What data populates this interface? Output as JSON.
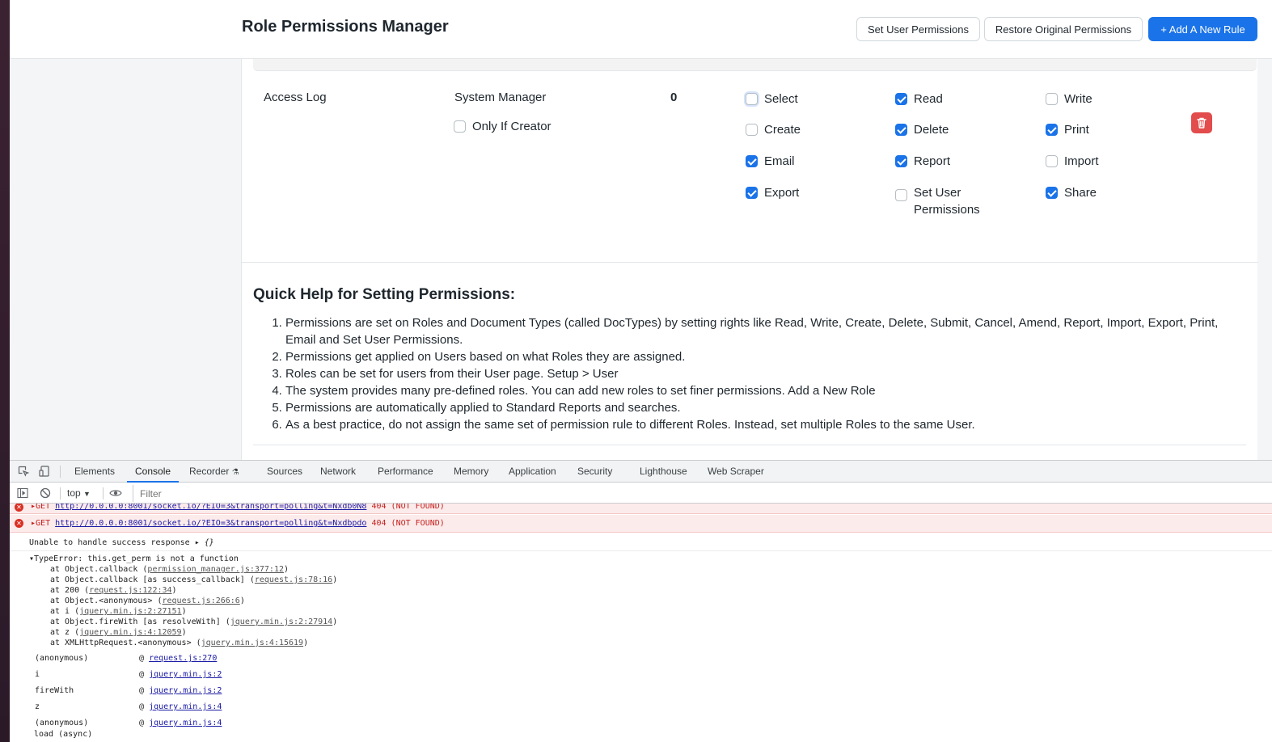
{
  "navbar": {
    "title": "Role Permissions Manager",
    "set_user_permissions": "Set User Permissions",
    "restore_original": "Restore Original Permissions",
    "add_rule": "+ Add A New Rule"
  },
  "permission_row": {
    "document": "Access Log",
    "role": "System Manager",
    "level": "0",
    "only_if_creator": {
      "label": "Only If Creator",
      "checked": false
    },
    "rights": [
      {
        "label": "Select",
        "checked": false
      },
      {
        "label": "Read",
        "checked": true
      },
      {
        "label": "Write",
        "checked": false
      },
      {
        "label": "Create",
        "checked": false
      },
      {
        "label": "Delete",
        "checked": true
      },
      {
        "label": "Print",
        "checked": true
      },
      {
        "label": "Email",
        "checked": true
      },
      {
        "label": "Report",
        "checked": true
      },
      {
        "label": "Import",
        "checked": false
      },
      {
        "label": "Export",
        "checked": true
      },
      {
        "label": "Set User Permissions",
        "checked": false
      },
      {
        "label": "Share",
        "checked": true
      }
    ],
    "delete_icon": "trash-icon"
  },
  "help": {
    "title": "Quick Help for Setting Permissions:",
    "items": [
      "Permissions are set on Roles and Document Types (called DocTypes) by setting rights like Read, Write, Create, Delete, Submit, Cancel, Amend, Report, Import, Export, Print, Email and Set User Permissions.",
      "Permissions get applied on Users based on what Roles they are assigned.",
      "Roles can be set for users from their User page.",
      "The system provides many pre-defined roles. You can add new roles to set finer permissions.",
      "Permissions are automatically applied to Standard Reports and searches.",
      "As a best practice, do not assign the same set of permission rule to different Roles. Instead, set multiple Roles to the same User."
    ],
    "link_setup_user": "Setup > User",
    "link_add_role": "Add a New Role"
  },
  "devtools": {
    "tabs": [
      "Elements",
      "Console",
      "Recorder",
      "Sources",
      "Network",
      "Performance",
      "Memory",
      "Application",
      "Security",
      "Lighthouse",
      "Web Scraper"
    ],
    "active_tab": "Console",
    "context": "top",
    "filter_placeholder": "Filter",
    "console": {
      "error1_prefix": "GET",
      "error1_url": "http://0.0.0.0:8001/socket.io/?EIO=3&transport=polling&t=Nxdb0N8",
      "error1_status": "404 (NOT FOUND)",
      "error2_prefix": "GET",
      "error2_url": "http://0.0.0.0:8001/socket.io/?EIO=3&transport=polling&t=Nxdbpdo",
      "error2_status": "404 (NOT FOUND)",
      "warn_text": "Unable to handle success response",
      "warn_obj": "{}",
      "type_error": "TypeError: this.get_perm is not a function",
      "stack": [
        {
          "text": "at Object.callback (",
          "link": "permission_manager.js:377:12"
        },
        {
          "text": "at Object.callback [as success_callback] (",
          "link": "request.js:78:16"
        },
        {
          "text": "at 200 (",
          "link": "request.js:122:34"
        },
        {
          "text": "at Object.<anonymous> (",
          "link": "request.js:266:6"
        },
        {
          "text": "at i (",
          "link": "jquery.min.js:2:27151"
        },
        {
          "text": "at Object.fireWith [as resolveWith] (",
          "link": "jquery.min.js:2:27914"
        },
        {
          "text": "at z (",
          "link": "jquery.min.js:4:12059"
        },
        {
          "text": "at XMLHttpRequest.<anonymous> (",
          "link": "jquery.min.js:4:15619"
        }
      ],
      "trace": [
        {
          "fn": "(anonymous)",
          "at": "@",
          "link": "request.js:270"
        },
        {
          "fn": "i",
          "at": "@",
          "link": "jquery.min.js:2"
        },
        {
          "fn": "fireWith",
          "at": "@",
          "link": "jquery.min.js:2"
        },
        {
          "fn": "z",
          "at": "@",
          "link": "jquery.min.js:4"
        },
        {
          "fn": "(anonymous)",
          "at": "@",
          "link": "jquery.min.js:4"
        }
      ],
      "last_line": "load (async)"
    }
  },
  "colors": {
    "primary": "#1a73e8",
    "danger": "#e24c4c",
    "error_bg": "#fcebeb"
  }
}
